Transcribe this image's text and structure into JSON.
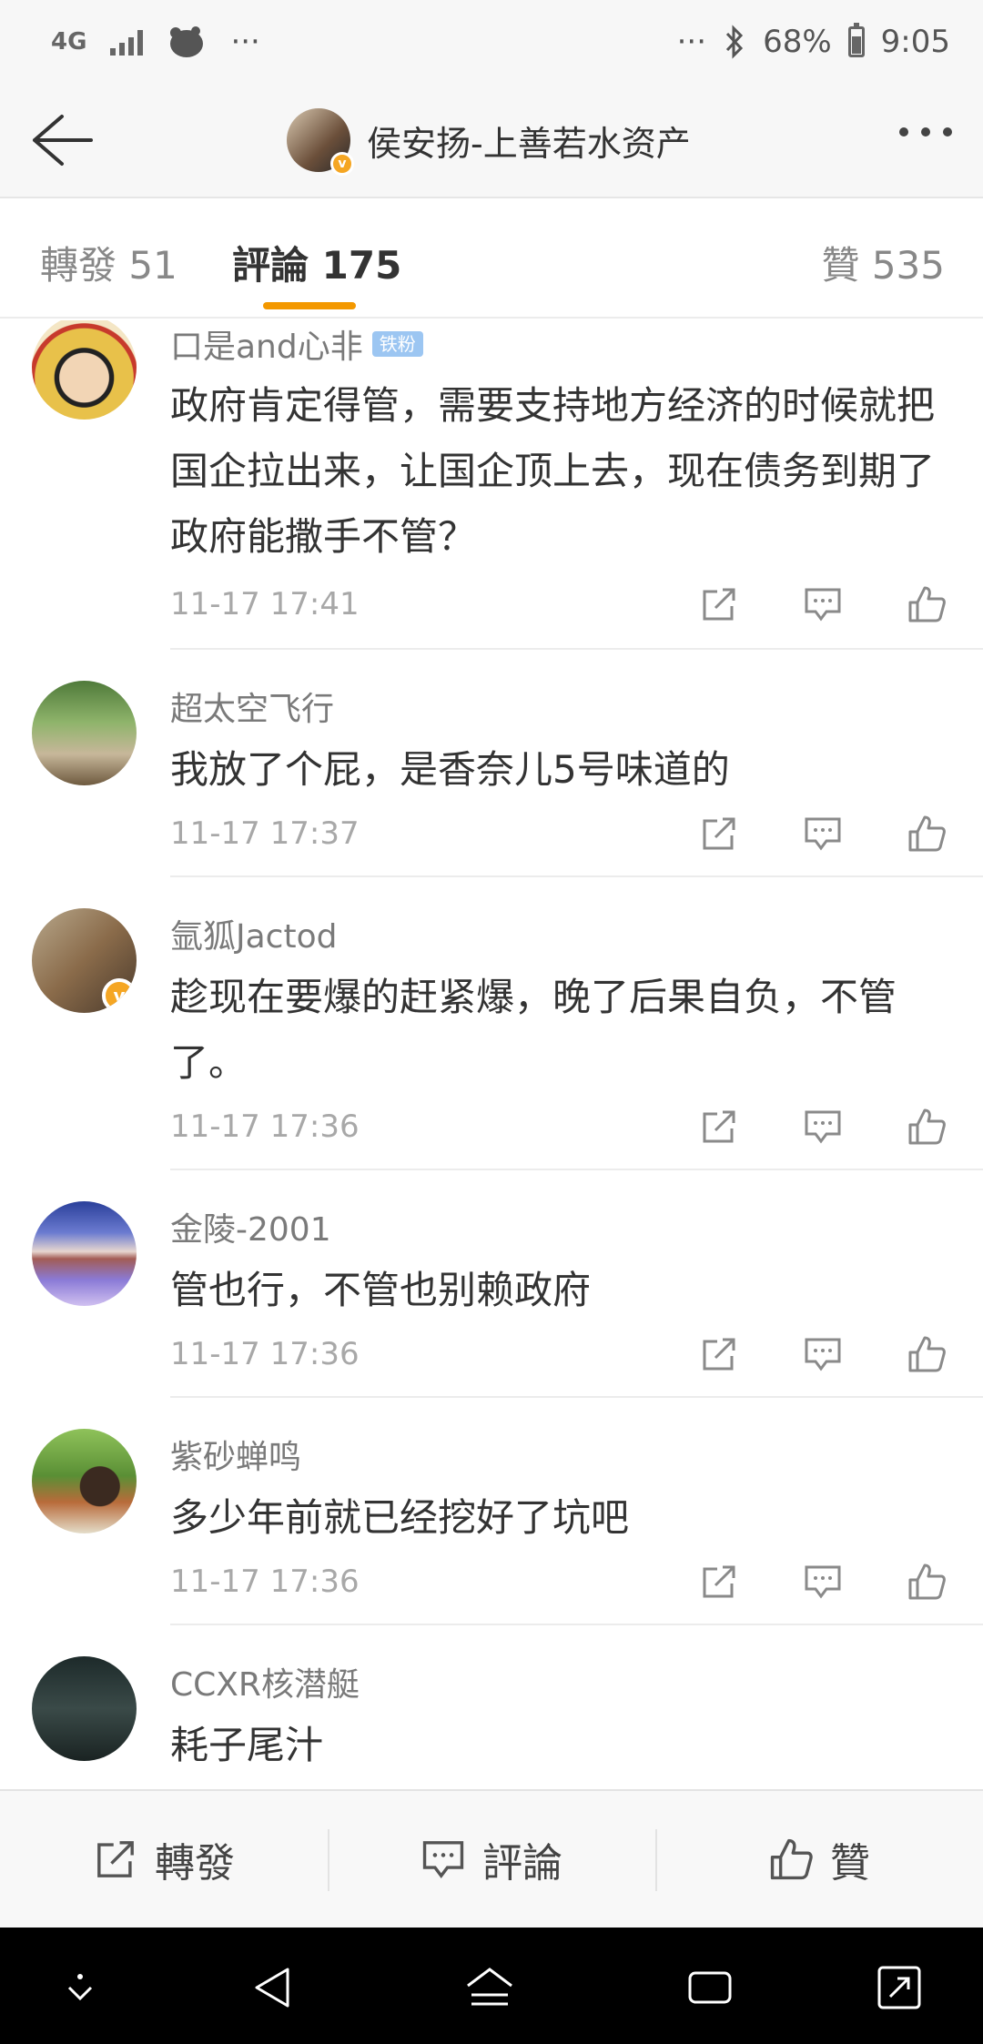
{
  "statusbar": {
    "network": "4G",
    "dots_left": "···",
    "dots_right": "···",
    "battery": "68%",
    "time": "9:05"
  },
  "header": {
    "title": "侯安扬-上善若水资产"
  },
  "tabs": {
    "repost": "轉發 51",
    "comment": "評論 175",
    "like": "贊 535"
  },
  "comments": [
    {
      "name": "口是and心非",
      "badge": "铁粉",
      "text": "政府肯定得管，需要支持地方经济的时候就把国企拉出来，让国企顶上去，现在债务到期了政府能撒手不管？",
      "time": "11-17 17:41"
    },
    {
      "name": "超太空飞行",
      "text": "我放了个屁，是香奈儿5号味道的",
      "time": "11-17 17:37"
    },
    {
      "name": "氩狐Jactod",
      "text": "趁现在要爆的赶紧爆，晚了后果自负，不管了。",
      "time": "11-17 17:36"
    },
    {
      "name": "金陵-2001",
      "text": "管也行，不管也别赖政府",
      "time": "11-17 17:36"
    },
    {
      "name": "紫砂蝉鸣",
      "text": "多少年前就已经挖好了坑吧",
      "time": "11-17 17:36"
    },
    {
      "name": "CCXR核潜艇",
      "text": "耗子尾汁",
      "time": ""
    }
  ],
  "bottombar": {
    "repost": "轉發",
    "comment": "評論",
    "like": "贊"
  },
  "colors": {
    "accent": "#f39800",
    "verified": "#f5a623",
    "fan_badge": "#9cc6f2"
  }
}
